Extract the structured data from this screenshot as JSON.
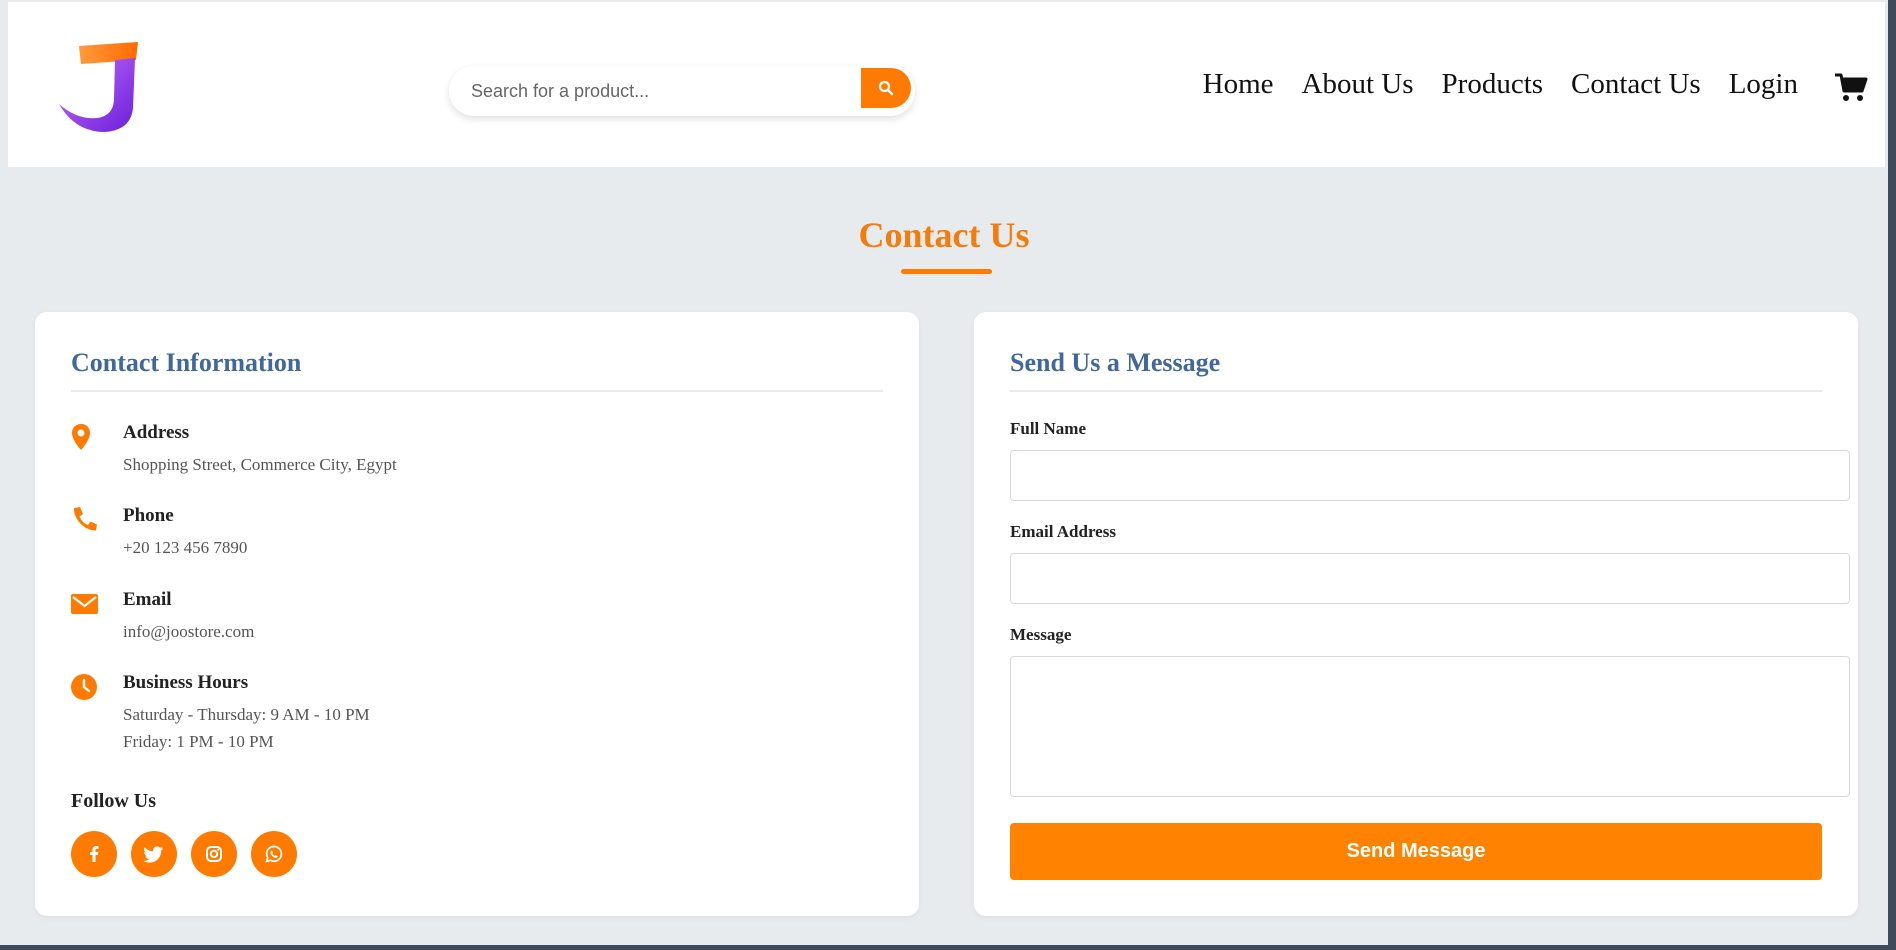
{
  "header": {
    "search": {
      "placeholder": "Search for a product..."
    },
    "nav": [
      "Home",
      "About Us",
      "Products",
      "Contact Us",
      "Login"
    ]
  },
  "page": {
    "title": "Contact Us"
  },
  "contact_info": {
    "title": "Contact Information",
    "items": [
      {
        "icon": "location-pin-icon",
        "label": "Address",
        "lines": [
          "Shopping Street, Commerce City, Egypt"
        ]
      },
      {
        "icon": "phone-icon",
        "label": "Phone",
        "lines": [
          "+20 123 456 7890"
        ]
      },
      {
        "icon": "envelope-icon",
        "label": "Email",
        "lines": [
          "info@joostore.com"
        ]
      },
      {
        "icon": "clock-icon",
        "label": "Business Hours",
        "lines": [
          "Saturday - Thursday: 9 AM - 10 PM",
          "Friday: 1 PM - 10 PM"
        ]
      }
    ],
    "follow_label": "Follow Us",
    "socials": [
      "facebook-icon",
      "twitter-icon",
      "instagram-icon",
      "whatsapp-icon"
    ]
  },
  "message_form": {
    "title": "Send Us a Message",
    "full_name_label": "Full Name",
    "full_name_value": "",
    "email_label": "Email Address",
    "email_value": "",
    "message_label": "Message",
    "message_value": "",
    "submit_label": "Send Message"
  },
  "colors": {
    "accent": "#ff7a00",
    "heading_blue": "#41689c",
    "page_bg": "#e8ebee"
  }
}
